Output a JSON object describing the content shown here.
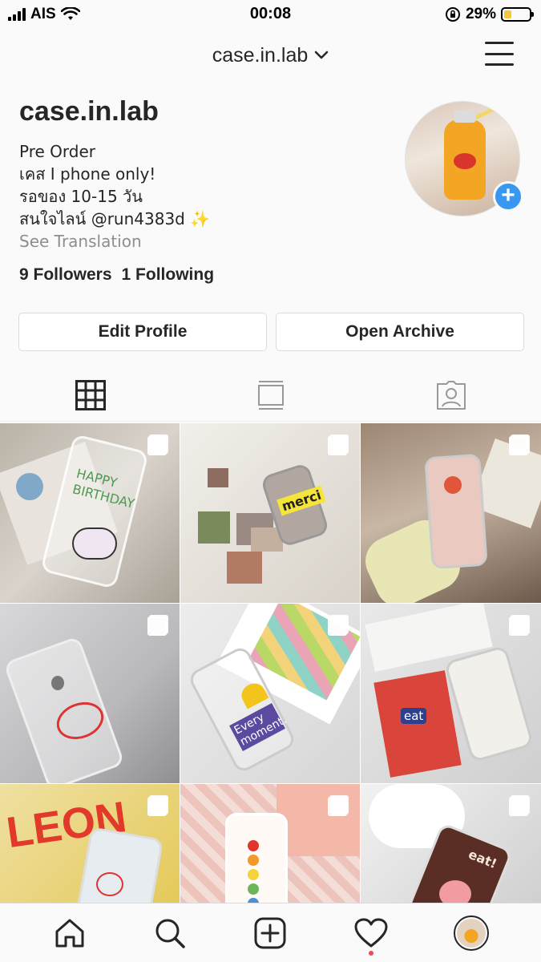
{
  "status_bar": {
    "carrier": "AIS",
    "time": "00:08",
    "battery_percent": "29%",
    "battery_level": 0.29,
    "battery_color": "#f6c73b"
  },
  "header": {
    "title": "case.in.lab"
  },
  "profile": {
    "username": "case.in.lab",
    "bio_lines": [
      "Pre Order",
      "เคส I phone only!",
      "รอของ 10-15 วัน",
      "สนใจไลน์ @run4383d ✨"
    ],
    "see_translation": "See Translation",
    "followers": "9 Followers",
    "following": "1 Following"
  },
  "buttons": {
    "edit_profile": "Edit Profile",
    "open_archive": "Open Archive"
  },
  "tabs": [
    "grid-icon",
    "feed-icon",
    "tagged-icon"
  ],
  "posts": [
    {
      "text": "HAPPY BIRTHDAY",
      "bg": "#c9c2b8"
    },
    {
      "text": "merci",
      "bg": "#e9e5de"
    },
    {
      "text": "",
      "bg": "#8a7a6a"
    },
    {
      "text": "",
      "bg": "#c7c7c9"
    },
    {
      "text": "Every moment.",
      "bg": "#e6e6e6"
    },
    {
      "text": "eat",
      "bg": "#dcdcdc"
    },
    {
      "text": "LEON",
      "bg": "#e8c94a"
    },
    {
      "text": "",
      "bg": "#f1d7d2"
    },
    {
      "text": "eat!",
      "bg": "#d6d6d6"
    }
  ],
  "colors": {
    "accent": "#3897f0",
    "notification": "#ed4956",
    "text": "#262626",
    "muted": "#8e8e8e"
  }
}
